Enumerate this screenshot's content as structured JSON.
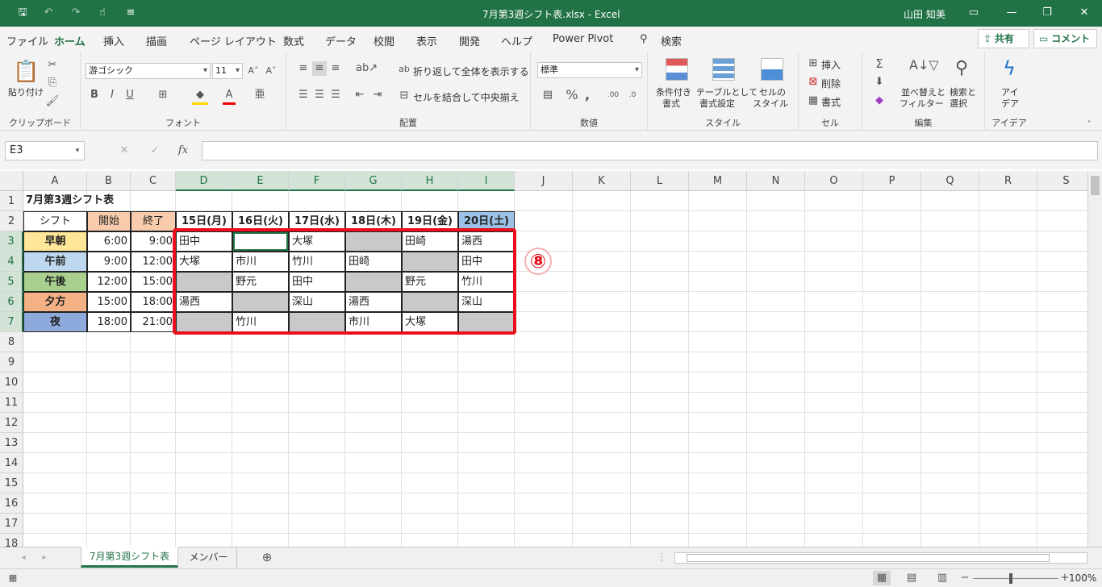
{
  "titlebar": {
    "title": "7月第3週シフト表.xlsx  -  Excel",
    "user": "山田 知美"
  },
  "menu": [
    "ファイル",
    "ホーム",
    "挿入",
    "描画",
    "ページ レイアウト",
    "数式",
    "データ",
    "校閲",
    "表示",
    "開発",
    "ヘルプ",
    "Power Pivot",
    "検索"
  ],
  "share": {
    "share": "共有",
    "comment": "コメント"
  },
  "ribbon": {
    "clipboard": {
      "paste": "貼り付け",
      "label": "クリップボード"
    },
    "font": {
      "name": "游ゴシック",
      "size": "11",
      "label": "フォント"
    },
    "align": {
      "wrap": "折り返して全体を表示する",
      "merge": "セルを結合して中央揃え",
      "label": "配置"
    },
    "number": {
      "format": "標準",
      "label": "数値"
    },
    "style": {
      "cond": "条件付き",
      "cond2": "書式",
      "table": "テーブルとして",
      "table2": "書式設定",
      "cellstyle": "セルの",
      "cellstyle2": "スタイル",
      "label": "スタイル"
    },
    "cells": {
      "insert": "挿入",
      "delete": "削除",
      "format": "書式",
      "label": "セル"
    },
    "edit": {
      "sort": "並べ替えと",
      "sort2": "フィルター",
      "find": "検索と",
      "find2": "選択",
      "label": "編集"
    },
    "ideas": {
      "ideas": "アイ",
      "ideas2": "デア",
      "label": "アイデア"
    }
  },
  "formula": {
    "namebox": "E3",
    "fx": "fx",
    "value": ""
  },
  "columns": [
    "A",
    "B",
    "C",
    "D",
    "E",
    "F",
    "G",
    "H",
    "I",
    "J",
    "K",
    "L",
    "M",
    "N",
    "O",
    "P",
    "Q",
    "R",
    "S"
  ],
  "rows": [
    "1",
    "2",
    "3",
    "4",
    "5",
    "6",
    "7",
    "8",
    "9",
    "10",
    "11",
    "12",
    "13",
    "14",
    "15",
    "16",
    "17",
    "18"
  ],
  "sheet": {
    "title": "7月第3週シフト表",
    "headers": [
      "シフト",
      "開始",
      "終了",
      "15日(月)",
      "16日(火)",
      "17日(水)",
      "18日(木)",
      "19日(金)",
      "20日(土)"
    ],
    "shifts": [
      {
        "name": "早朝",
        "start": "6:00",
        "end": "9:00",
        "color": "#ffe699",
        "days": [
          "田中",
          "",
          "大塚",
          "#",
          "田崎",
          "湯西"
        ]
      },
      {
        "name": "午前",
        "start": "9:00",
        "end": "12:00",
        "color": "#bdd7ee",
        "days": [
          "大塚",
          "市川",
          "竹川",
          "田崎",
          "#",
          "田中"
        ]
      },
      {
        "name": "午後",
        "start": "12:00",
        "end": "15:00",
        "color": "#a9d08e",
        "days": [
          "#",
          "野元",
          "田中",
          "#",
          "野元",
          "竹川"
        ]
      },
      {
        "name": "夕方",
        "start": "15:00",
        "end": "18:00",
        "color": "#f4b183",
        "days": [
          "湯西",
          "#",
          "深山",
          "湯西",
          "#",
          "深山"
        ]
      },
      {
        "name": "夜",
        "start": "18:00",
        "end": "21:00",
        "color": "#8ea9db",
        "days": [
          "#",
          "竹川",
          "#",
          "市川",
          "大塚",
          "#"
        ]
      }
    ]
  },
  "annotation": "⑧",
  "tabs": {
    "active": "7月第3週シフト表",
    "other": "メンバー"
  },
  "status": {
    "zoom": "100%"
  }
}
